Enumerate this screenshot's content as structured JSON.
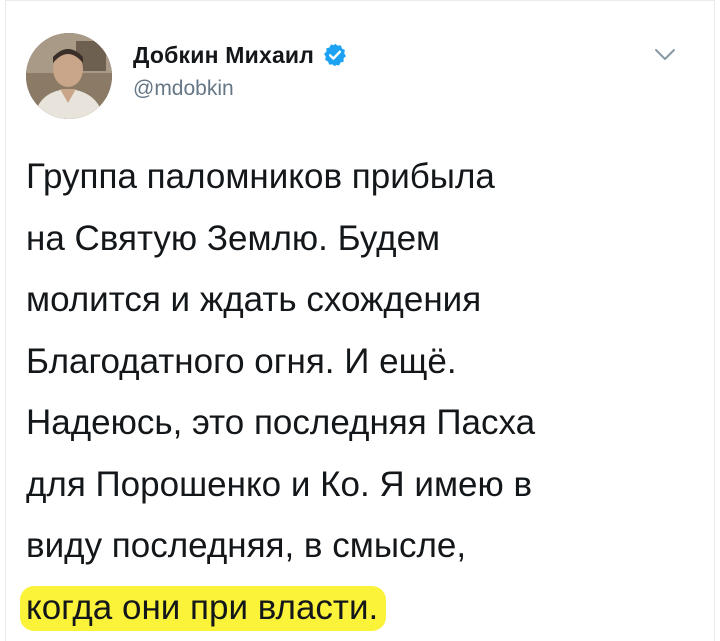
{
  "author": {
    "display_name": "Добкин Михаил",
    "handle": "@mdobkin",
    "verified": true,
    "avatar_icon": "user-photo-avatar",
    "verified_icon": "verified-badge-icon",
    "menu_icon": "chevron-down-icon"
  },
  "tweet": {
    "lines": [
      "Группа паломников прибыла",
      "на Святую Землю.  Будем",
      "молится и ждать схождения",
      "Благодатного огня. И ещё.",
      "Надеюсь, это последняя Пасха",
      "для Порошенко и Ко. Я имею в",
      "виду последняя, в смысле,"
    ],
    "highlighted_line": "когда они при власти."
  },
  "colors": {
    "text": "#14171a",
    "muted": "#657786",
    "verified_blue": "#1da1f2",
    "highlight": "#fbf33a"
  }
}
